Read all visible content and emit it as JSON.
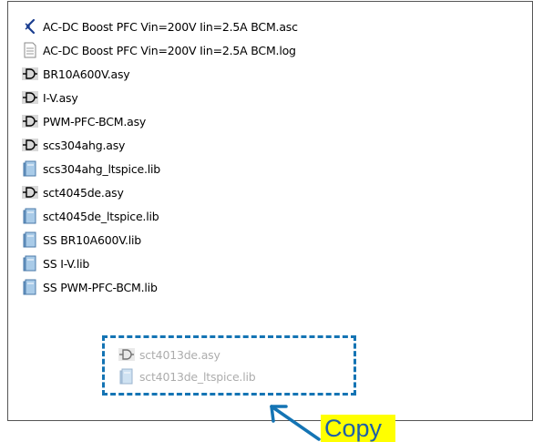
{
  "files": [
    {
      "name": "AC-DC Boost PFC Vin=200V Iin=2.5A BCM.asc",
      "icon": "ltspice-schematic-icon"
    },
    {
      "name": "AC-DC Boost PFC Vin=200V Iin=2.5A BCM.log",
      "icon": "text-document-icon"
    },
    {
      "name": "BR10A600V.asy",
      "icon": "symbol-file-icon"
    },
    {
      "name": "I-V.asy",
      "icon": "symbol-file-icon"
    },
    {
      "name": "PWM-PFC-BCM.asy",
      "icon": "symbol-file-icon"
    },
    {
      "name": "scs304ahg.asy",
      "icon": "symbol-file-icon"
    },
    {
      "name": "scs304ahg_ltspice.lib",
      "icon": "library-file-icon"
    },
    {
      "name": "sct4045de.asy",
      "icon": "symbol-file-icon"
    },
    {
      "name": "sct4045de_ltspice.lib",
      "icon": "library-file-icon"
    },
    {
      "name": "SS BR10A600V.lib",
      "icon": "library-file-icon"
    },
    {
      "name": "SS I-V.lib",
      "icon": "library-file-icon"
    },
    {
      "name": "SS PWM-PFC-BCM.lib",
      "icon": "library-file-icon"
    }
  ],
  "dragged_files": [
    {
      "name": "sct4013de.asy",
      "icon": "symbol-file-icon"
    },
    {
      "name": "sct4013de_ltspice.lib",
      "icon": "library-file-icon"
    }
  ],
  "annotation": {
    "label": "Copy",
    "label_bg": "#ffff00",
    "label_color": "#1d5fa8",
    "box_color": "#1474b4"
  }
}
